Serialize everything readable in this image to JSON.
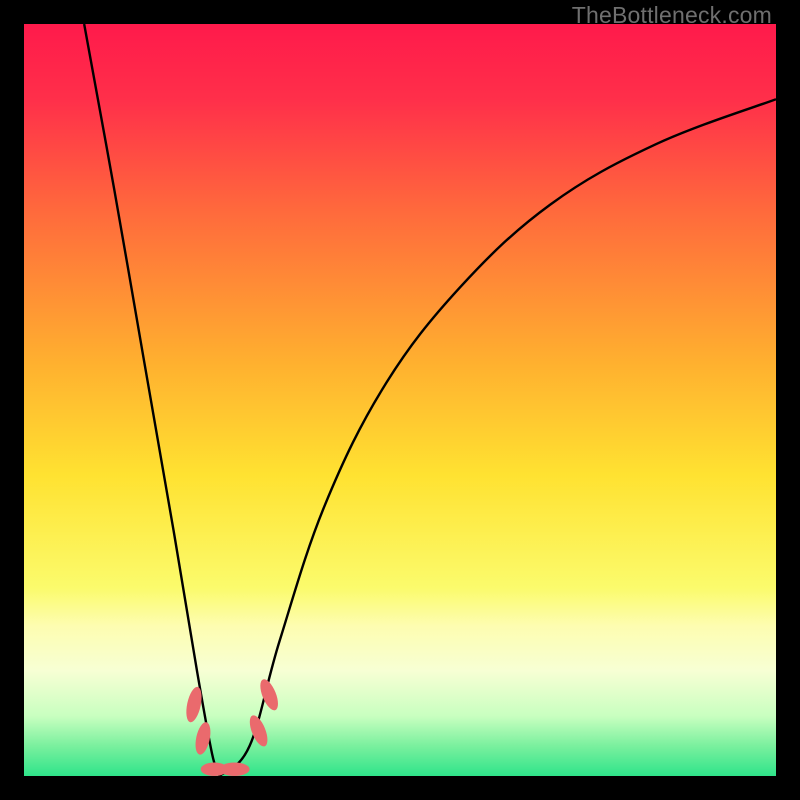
{
  "watermark": "TheBottleneck.com",
  "chart_data": {
    "type": "line",
    "title": "",
    "xlabel": "",
    "ylabel": "",
    "xlim": [
      0,
      100
    ],
    "ylim": [
      0,
      100
    ],
    "background_gradient": {
      "stops": [
        {
          "y_pct": 0,
          "color": "#ff1a4b"
        },
        {
          "y_pct": 10,
          "color": "#ff2f4a"
        },
        {
          "y_pct": 25,
          "color": "#ff6a3c"
        },
        {
          "y_pct": 45,
          "color": "#ffb02f"
        },
        {
          "y_pct": 60,
          "color": "#ffe231"
        },
        {
          "y_pct": 75,
          "color": "#fbfb6c"
        },
        {
          "y_pct": 80,
          "color": "#fdfdb0"
        },
        {
          "y_pct": 86,
          "color": "#f7ffd4"
        },
        {
          "y_pct": 92,
          "color": "#c9ffc0"
        },
        {
          "y_pct": 96,
          "color": "#7af09e"
        },
        {
          "y_pct": 100,
          "color": "#2fe48a"
        }
      ]
    },
    "series": [
      {
        "name": "bottleneck-curve",
        "color": "#000000",
        "notch_x": 26,
        "left_branch": [
          {
            "x": 8,
            "y": 100
          },
          {
            "x": 12,
            "y": 78
          },
          {
            "x": 16,
            "y": 55
          },
          {
            "x": 20,
            "y": 32
          },
          {
            "x": 23,
            "y": 14
          },
          {
            "x": 25,
            "y": 3
          },
          {
            "x": 26,
            "y": 0
          }
        ],
        "right_branch": [
          {
            "x": 26,
            "y": 0
          },
          {
            "x": 30,
            "y": 4
          },
          {
            "x": 34,
            "y": 18
          },
          {
            "x": 40,
            "y": 36
          },
          {
            "x": 48,
            "y": 52
          },
          {
            "x": 58,
            "y": 65
          },
          {
            "x": 70,
            "y": 76
          },
          {
            "x": 84,
            "y": 84
          },
          {
            "x": 100,
            "y": 90
          }
        ]
      }
    ],
    "markers": [
      {
        "name": "marker-l1",
        "cx": 22.6,
        "cy": 9.5,
        "rx": 0.9,
        "ry": 2.4,
        "rot": 12
      },
      {
        "name": "marker-l2",
        "cx": 23.8,
        "cy": 5.0,
        "rx": 0.9,
        "ry": 2.2,
        "rot": 12
      },
      {
        "name": "marker-b1",
        "cx": 25.3,
        "cy": 0.9,
        "rx": 1.8,
        "ry": 0.9,
        "rot": 0
      },
      {
        "name": "marker-b2",
        "cx": 28.0,
        "cy": 0.9,
        "rx": 2.0,
        "ry": 0.9,
        "rot": 0
      },
      {
        "name": "marker-r1",
        "cx": 31.2,
        "cy": 6.0,
        "rx": 0.9,
        "ry": 2.2,
        "rot": -22
      },
      {
        "name": "marker-r2",
        "cx": 32.6,
        "cy": 10.8,
        "rx": 0.9,
        "ry": 2.2,
        "rot": -22
      }
    ],
    "marker_color": "#ea6a6d"
  }
}
